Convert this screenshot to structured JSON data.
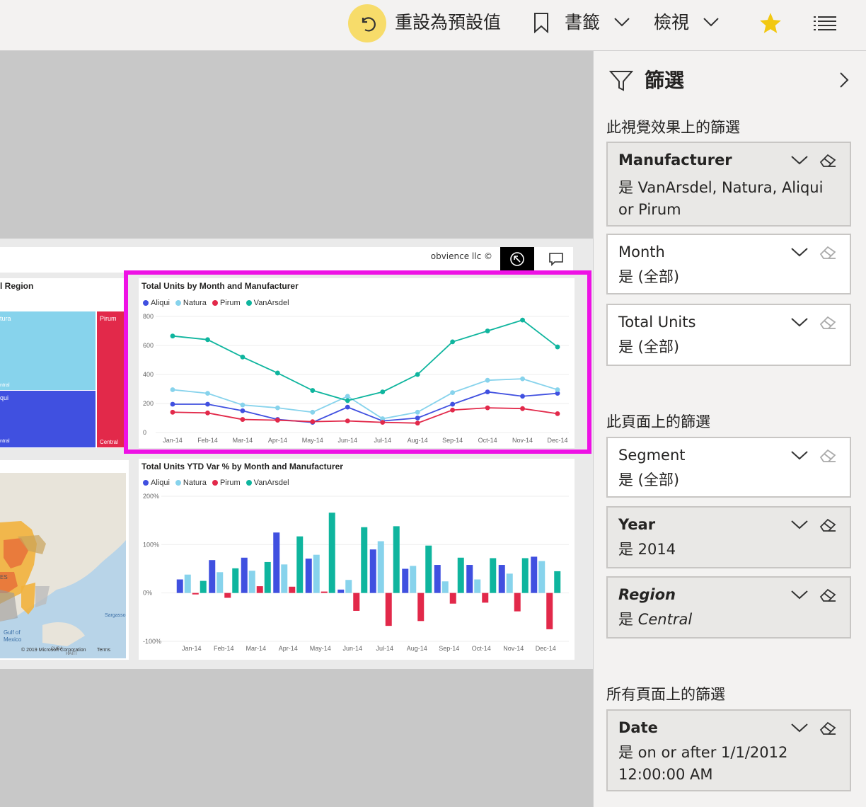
{
  "toolbar": {
    "reset_label": "重設為預設值",
    "bookmarks_label": "書籤",
    "view_label": "檢視"
  },
  "report": {
    "credit": "obvience llc ©",
    "treemap": {
      "title_partial": "l Region",
      "labels": [
        "tura",
        "Pirum",
        "ntral",
        "qui",
        "ntral",
        "Central"
      ]
    },
    "map": {
      "labels": [
        "ES",
        "Gulf of",
        "Mexico",
        "Sargasso",
        "CUBA",
        "HAITI",
        "© 2019 Microsoft Corporation",
        "Terms"
      ]
    }
  },
  "filters": {
    "pane_title": "篩選",
    "visual_section": "此視覺效果上的篩選",
    "page_section": "此頁面上的篩選",
    "all_section": "所有頁面上的篩選",
    "visual": [
      {
        "name": "Manufacturer",
        "value": "是 VanArsdel, Natura, Aliqui or Pirum",
        "active": true
      },
      {
        "name": "Month",
        "value": "是 (全部)",
        "active": false
      },
      {
        "name": "Total Units",
        "value": "是 (全部)",
        "active": false
      }
    ],
    "page": [
      {
        "name": "Segment",
        "value": "是 (全部)",
        "active": false
      },
      {
        "name": "Year",
        "value": "是 2014",
        "active": true
      },
      {
        "name": "Region",
        "value_prefix": "是 ",
        "value_italic": "Central",
        "active": true
      }
    ],
    "all": [
      {
        "name": "Date",
        "value": "是 on or after 1/1/2012 12:00:00 AM",
        "active": true
      }
    ]
  },
  "colors": {
    "Aliqui": "#4050e0",
    "Natura": "#87d3ec",
    "Pirum": "#e2294a",
    "VanArsdel": "#0fb59e",
    "highlight": "#ee11e5",
    "star": "#f2c811"
  },
  "chart_data": [
    {
      "type": "line",
      "title": "Total Units by Month and Manufacturer",
      "categories": [
        "Jan-14",
        "Feb-14",
        "Mar-14",
        "Apr-14",
        "May-14",
        "Jun-14",
        "Jul-14",
        "Aug-14",
        "Sep-14",
        "Oct-14",
        "Nov-14",
        "Dec-14"
      ],
      "ylim": [
        0,
        800
      ],
      "yticks": [
        0,
        200,
        400,
        600,
        800
      ],
      "series": [
        {
          "name": "Aliqui",
          "values": [
            195,
            195,
            150,
            90,
            70,
            175,
            80,
            100,
            195,
            280,
            250,
            270
          ]
        },
        {
          "name": "Natura",
          "values": [
            295,
            270,
            190,
            170,
            140,
            250,
            95,
            140,
            275,
            360,
            370,
            295
          ]
        },
        {
          "name": "Pirum",
          "values": [
            140,
            135,
            90,
            85,
            75,
            80,
            70,
            65,
            155,
            170,
            165,
            130
          ]
        },
        {
          "name": "VanArsdel",
          "values": [
            665,
            640,
            520,
            410,
            290,
            220,
            280,
            400,
            625,
            700,
            775,
            590
          ]
        }
      ],
      "legend": "top-left"
    },
    {
      "type": "bar",
      "title": "Total Units YTD Var % by Month and Manufacturer",
      "categories": [
        "Jan-14",
        "Feb-14",
        "Mar-14",
        "Apr-14",
        "May-14",
        "Jun-14",
        "Jul-14",
        "Aug-14",
        "Sep-14",
        "Oct-14",
        "Nov-14",
        "Dec-14"
      ],
      "ylim": [
        -100,
        200
      ],
      "yticks": [
        -100,
        0,
        100,
        200
      ],
      "ytick_labels": [
        "-100%",
        "0%",
        "100%",
        "200%"
      ],
      "series": [
        {
          "name": "Aliqui",
          "values": [
            28,
            68,
            73,
            125,
            71,
            7,
            90,
            50,
            58,
            58,
            58,
            75
          ]
        },
        {
          "name": "Natura",
          "values": [
            38,
            43,
            46,
            59,
            79,
            27,
            107,
            56,
            24,
            28,
            40,
            66
          ]
        },
        {
          "name": "Pirum",
          "values": [
            -3,
            -10,
            14,
            13,
            3,
            -37,
            -68,
            -58,
            -22,
            -20,
            -38,
            -75
          ]
        },
        {
          "name": "VanArsdel",
          "values": [
            25,
            51,
            64,
            117,
            166,
            136,
            138,
            98,
            73,
            72,
            72,
            45
          ]
        }
      ],
      "legend": "top-left"
    }
  ]
}
